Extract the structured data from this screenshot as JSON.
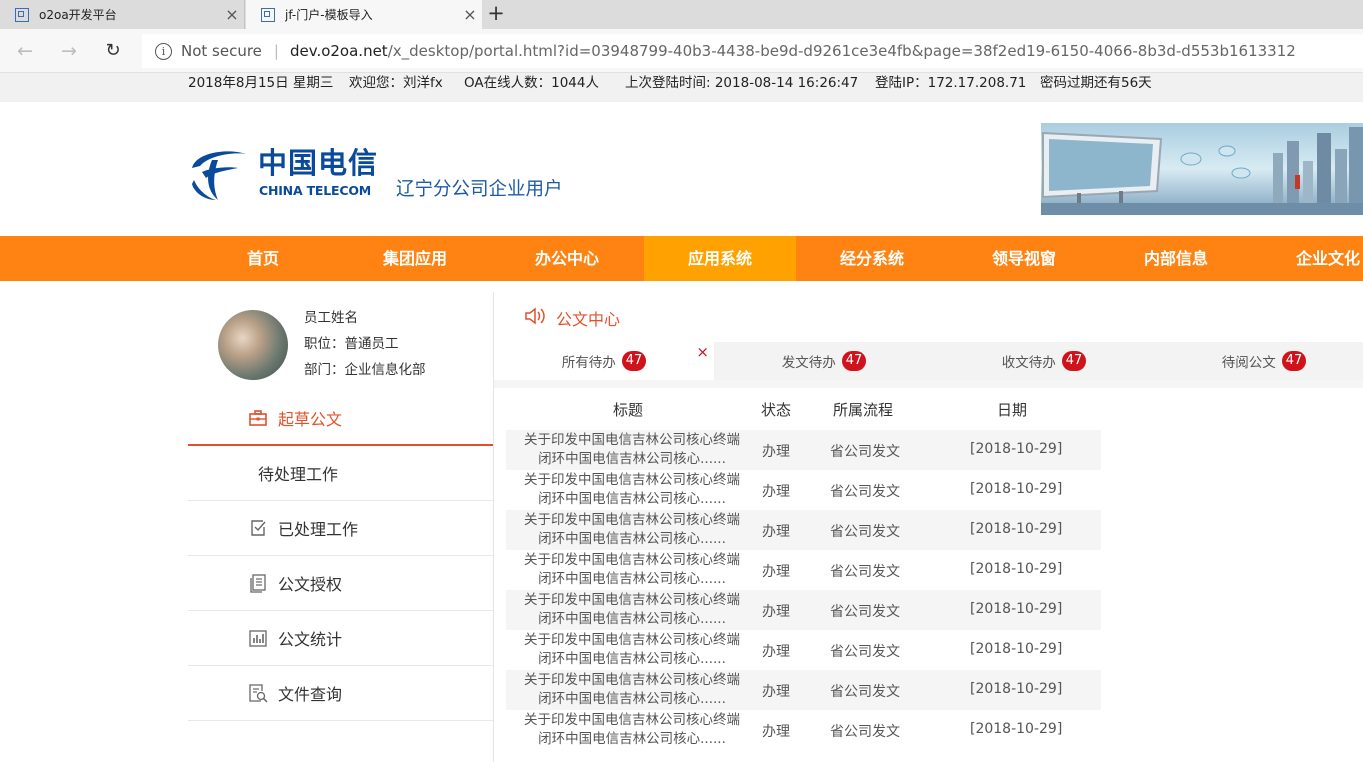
{
  "browser": {
    "tabs": [
      {
        "title": "o2oa开发平台",
        "close": "×"
      },
      {
        "title": "jf-门户-模板导入",
        "close": "×"
      }
    ],
    "new_tab": "+",
    "back": "←",
    "forward": "→",
    "reload": "↻",
    "info": "i",
    "security": "Not secure",
    "url_host": "dev.o2oa.net",
    "url_rest": "/x_desktop/portal.html?id=03948799-40b3-4438-be9d-d9261ce3e4fb&page=38f2ed19-6150-4066-8b3d-d553b1613312"
  },
  "infobar": {
    "date": "2018年8月15日 星期三",
    "welcome": "欢迎您：刘洋fx",
    "online": "OA在线人数：1044人",
    "last_login": "上次登陆时间: 2018-08-14 16:26:47",
    "login_ip": "登陆IP：172.17.208.71",
    "pwd_expire": "密码过期还有56天"
  },
  "header": {
    "logo_cn": "中国电信",
    "logo_en": "CHINA TELECOM",
    "company": "辽宁分公司企业用户"
  },
  "nav": {
    "items": [
      {
        "label": "首页"
      },
      {
        "label": "集团应用"
      },
      {
        "label": "办公中心"
      },
      {
        "label": "应用系统"
      },
      {
        "label": "经分系统"
      },
      {
        "label": "领导视窗"
      },
      {
        "label": "内部信息"
      },
      {
        "label": "企业文化"
      }
    ],
    "active_index": 3
  },
  "profile": {
    "name": "员工姓名",
    "position": "职位：普通员工",
    "department": "部门：企业信息化部"
  },
  "side_menu": {
    "items": [
      {
        "label": "起草公文",
        "icon": "briefcase-icon"
      },
      {
        "label": "待处理工作",
        "icon": ""
      },
      {
        "label": "已处理工作",
        "icon": "checkbox-icon"
      },
      {
        "label": "公文授权",
        "icon": "document-stack-icon"
      },
      {
        "label": "公文统计",
        "icon": "bar-chart-icon"
      },
      {
        "label": "文件查询",
        "icon": "file-search-icon"
      }
    ]
  },
  "section": {
    "title": "公文中心",
    "tabs": [
      {
        "label": "所有待办",
        "count": "47",
        "close": "×"
      },
      {
        "label": "发文待办",
        "count": "47"
      },
      {
        "label": "收文待办",
        "count": "47"
      },
      {
        "label": "待阅公文",
        "count": "47"
      }
    ]
  },
  "table": {
    "headers": [
      "标题",
      "状态",
      "所属流程",
      "日期"
    ],
    "rows": [
      {
        "line1": "关于印发中国电信吉林公司核心终端",
        "line2": "闭环中国电信吉林公司核心......",
        "status": "办理",
        "flow": "省公司发文",
        "date": "[2018-10-29]"
      },
      {
        "line1": "关于印发中国电信吉林公司核心终端",
        "line2": "闭环中国电信吉林公司核心......",
        "status": "办理",
        "flow": "省公司发文",
        "date": "[2018-10-29]"
      },
      {
        "line1": "关于印发中国电信吉林公司核心终端",
        "line2": "闭环中国电信吉林公司核心......",
        "status": "办理",
        "flow": "省公司发文",
        "date": "[2018-10-29]"
      },
      {
        "line1": "关于印发中国电信吉林公司核心终端",
        "line2": "闭环中国电信吉林公司核心......",
        "status": "办理",
        "flow": "省公司发文",
        "date": "[2018-10-29]"
      },
      {
        "line1": "关于印发中国电信吉林公司核心终端",
        "line2": "闭环中国电信吉林公司核心......",
        "status": "办理",
        "flow": "省公司发文",
        "date": "[2018-10-29]"
      },
      {
        "line1": "关于印发中国电信吉林公司核心终端",
        "line2": "闭环中国电信吉林公司核心......",
        "status": "办理",
        "flow": "省公司发文",
        "date": "[2018-10-29]"
      },
      {
        "line1": "关于印发中国电信吉林公司核心终端",
        "line2": "闭环中国电信吉林公司核心......",
        "status": "办理",
        "flow": "省公司发文",
        "date": "[2018-10-29]"
      },
      {
        "line1": "关于印发中国电信吉林公司核心终端",
        "line2": "闭环中国电信吉林公司核心......",
        "status": "办理",
        "flow": "省公司发文",
        "date": "[2018-10-29]"
      }
    ]
  },
  "colors": {
    "nav_bg": "#ff8312",
    "nav_active": "#ffa100",
    "accent": "#e2512b",
    "badge": "#d0121b",
    "brand_blue": "#0a4a9c"
  }
}
